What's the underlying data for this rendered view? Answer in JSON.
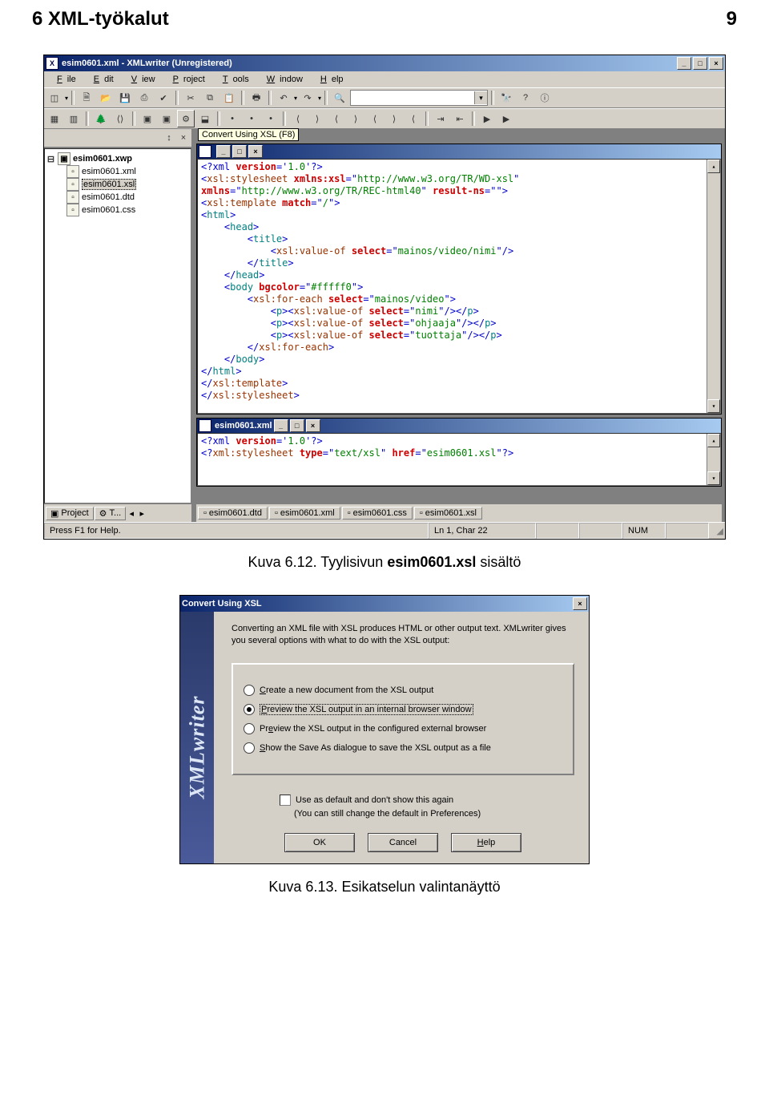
{
  "page": {
    "section": "6 XML-työkalut",
    "number": "9"
  },
  "caption1": {
    "prefix": "Kuva 6.12. Tyylisivun ",
    "bold": "esim0601.xsl",
    "suffix": " sisältö"
  },
  "caption2": "Kuva 6.13. Esikatselun valintanäyttö",
  "app": {
    "title": "esim0601.xml - XMLwriter (Unregistered)",
    "menus": [
      "File",
      "Edit",
      "View",
      "Project",
      "Tools",
      "Window",
      "Help"
    ],
    "tooltip": "Convert Using XSL (F8)",
    "tree": {
      "root": "esim0601.xwp",
      "items": [
        "esim0601.xml",
        "esim0601.xsl",
        "esim0601.dtd",
        "esim0601.css"
      ],
      "selected": 1
    },
    "side_tabs": {
      "project": "Project",
      "other": "T..."
    },
    "child1_title": "",
    "code1_lines": [
      {
        "segs": [
          {
            "c": "c-blue",
            "t": "<?xml "
          },
          {
            "c": "c-red",
            "t": "version"
          },
          {
            "c": "c-blue",
            "t": "='"
          },
          {
            "c": "c-grn",
            "t": "1.0"
          },
          {
            "c": "c-blue",
            "t": "'?>"
          }
        ]
      },
      {
        "segs": [
          {
            "c": "c-blue",
            "t": "<"
          },
          {
            "c": "c-brown",
            "t": "xsl:stylesheet "
          },
          {
            "c": "c-red",
            "t": "xmlns:xsl"
          },
          {
            "c": "c-blue",
            "t": "=\""
          },
          {
            "c": "c-grn",
            "t": "http://www.w3.org/TR/WD-xsl"
          },
          {
            "c": "c-blue",
            "t": "\""
          }
        ]
      },
      {
        "segs": [
          {
            "c": "c-red",
            "t": "xmlns"
          },
          {
            "c": "c-blue",
            "t": "=\""
          },
          {
            "c": "c-grn",
            "t": "http://www.w3.org/TR/REC-html40"
          },
          {
            "c": "c-blue",
            "t": "\" "
          },
          {
            "c": "c-red",
            "t": "result-ns"
          },
          {
            "c": "c-blue",
            "t": "=\"\">"
          }
        ]
      },
      {
        "segs": [
          {
            "c": "c-blue",
            "t": "<"
          },
          {
            "c": "c-brown",
            "t": "xsl:template "
          },
          {
            "c": "c-red",
            "t": "match"
          },
          {
            "c": "c-blue",
            "t": "=\""
          },
          {
            "c": "c-grn",
            "t": "/"
          },
          {
            "c": "c-blue",
            "t": "\">"
          }
        ]
      },
      {
        "segs": [
          {
            "c": "c-blue",
            "t": "<"
          },
          {
            "c": "c-teal",
            "t": "html"
          },
          {
            "c": "c-blue",
            "t": ">"
          }
        ]
      },
      {
        "segs": [
          {
            "c": "",
            "t": "    "
          },
          {
            "c": "c-blue",
            "t": "<"
          },
          {
            "c": "c-teal",
            "t": "head"
          },
          {
            "c": "c-blue",
            "t": ">"
          }
        ]
      },
      {
        "segs": [
          {
            "c": "",
            "t": "        "
          },
          {
            "c": "c-blue",
            "t": "<"
          },
          {
            "c": "c-teal",
            "t": "title"
          },
          {
            "c": "c-blue",
            "t": ">"
          }
        ]
      },
      {
        "segs": [
          {
            "c": "",
            "t": "            "
          },
          {
            "c": "c-blue",
            "t": "<"
          },
          {
            "c": "c-brown",
            "t": "xsl:value-of "
          },
          {
            "c": "c-red",
            "t": "select"
          },
          {
            "c": "c-blue",
            "t": "=\""
          },
          {
            "c": "c-grn",
            "t": "mainos/video/nimi"
          },
          {
            "c": "c-blue",
            "t": "\"/>"
          }
        ]
      },
      {
        "segs": [
          {
            "c": "",
            "t": "        "
          },
          {
            "c": "c-blue",
            "t": "</"
          },
          {
            "c": "c-teal",
            "t": "title"
          },
          {
            "c": "c-blue",
            "t": ">"
          }
        ]
      },
      {
        "segs": [
          {
            "c": "",
            "t": "    "
          },
          {
            "c": "c-blue",
            "t": "</"
          },
          {
            "c": "c-teal",
            "t": "head"
          },
          {
            "c": "c-blue",
            "t": ">"
          }
        ]
      },
      {
        "segs": [
          {
            "c": "",
            "t": "    "
          },
          {
            "c": "c-blue",
            "t": "<"
          },
          {
            "c": "c-teal",
            "t": "body "
          },
          {
            "c": "c-red",
            "t": "bgcolor"
          },
          {
            "c": "c-blue",
            "t": "=\""
          },
          {
            "c": "c-grn",
            "t": "#fffff0"
          },
          {
            "c": "c-blue",
            "t": "\">"
          }
        ]
      },
      {
        "segs": [
          {
            "c": "",
            "t": "        "
          },
          {
            "c": "c-blue",
            "t": "<"
          },
          {
            "c": "c-brown",
            "t": "xsl:for-each "
          },
          {
            "c": "c-red",
            "t": "select"
          },
          {
            "c": "c-blue",
            "t": "=\""
          },
          {
            "c": "c-grn",
            "t": "mainos/video"
          },
          {
            "c": "c-blue",
            "t": "\">"
          }
        ]
      },
      {
        "segs": [
          {
            "c": "",
            "t": "            "
          },
          {
            "c": "c-blue",
            "t": "<"
          },
          {
            "c": "c-teal",
            "t": "p"
          },
          {
            "c": "c-blue",
            "t": "><"
          },
          {
            "c": "c-brown",
            "t": "xsl:value-of "
          },
          {
            "c": "c-red",
            "t": "select"
          },
          {
            "c": "c-blue",
            "t": "=\""
          },
          {
            "c": "c-grn",
            "t": "nimi"
          },
          {
            "c": "c-blue",
            "t": "\"/></"
          },
          {
            "c": "c-teal",
            "t": "p"
          },
          {
            "c": "c-blue",
            "t": ">"
          }
        ]
      },
      {
        "segs": [
          {
            "c": "",
            "t": "            "
          },
          {
            "c": "c-blue",
            "t": "<"
          },
          {
            "c": "c-teal",
            "t": "p"
          },
          {
            "c": "c-blue",
            "t": "><"
          },
          {
            "c": "c-brown",
            "t": "xsl:value-of "
          },
          {
            "c": "c-red",
            "t": "select"
          },
          {
            "c": "c-blue",
            "t": "=\""
          },
          {
            "c": "c-grn",
            "t": "ohjaaja"
          },
          {
            "c": "c-blue",
            "t": "\"/></"
          },
          {
            "c": "c-teal",
            "t": "p"
          },
          {
            "c": "c-blue",
            "t": ">"
          }
        ]
      },
      {
        "segs": [
          {
            "c": "",
            "t": "            "
          },
          {
            "c": "c-blue",
            "t": "<"
          },
          {
            "c": "c-teal",
            "t": "p"
          },
          {
            "c": "c-blue",
            "t": "><"
          },
          {
            "c": "c-brown",
            "t": "xsl:value-of "
          },
          {
            "c": "c-red",
            "t": "select"
          },
          {
            "c": "c-blue",
            "t": "=\""
          },
          {
            "c": "c-grn",
            "t": "tuottaja"
          },
          {
            "c": "c-blue",
            "t": "\"/></"
          },
          {
            "c": "c-teal",
            "t": "p"
          },
          {
            "c": "c-blue",
            "t": ">"
          }
        ]
      },
      {
        "segs": [
          {
            "c": "",
            "t": "        "
          },
          {
            "c": "c-blue",
            "t": "</"
          },
          {
            "c": "c-brown",
            "t": "xsl:for-each"
          },
          {
            "c": "c-blue",
            "t": ">"
          }
        ]
      },
      {
        "segs": [
          {
            "c": "",
            "t": "    "
          },
          {
            "c": "c-blue",
            "t": "</"
          },
          {
            "c": "c-teal",
            "t": "body"
          },
          {
            "c": "c-blue",
            "t": ">"
          }
        ]
      },
      {
        "segs": [
          {
            "c": "c-blue",
            "t": "</"
          },
          {
            "c": "c-teal",
            "t": "html"
          },
          {
            "c": "c-blue",
            "t": ">"
          }
        ]
      },
      {
        "segs": [
          {
            "c": "c-blue",
            "t": "</"
          },
          {
            "c": "c-brown",
            "t": "xsl:template"
          },
          {
            "c": "c-blue",
            "t": ">"
          }
        ]
      },
      {
        "segs": [
          {
            "c": "c-blue",
            "t": "</"
          },
          {
            "c": "c-brown",
            "t": "xsl:stylesheet"
          },
          {
            "c": "c-blue",
            "t": ">"
          }
        ]
      }
    ],
    "child2_title": "esim0601.xml",
    "code2_lines": [
      {
        "segs": [
          {
            "c": "c-blue",
            "t": "<?xml "
          },
          {
            "c": "c-red",
            "t": "version"
          },
          {
            "c": "c-blue",
            "t": "='"
          },
          {
            "c": "c-grn",
            "t": "1.0"
          },
          {
            "c": "c-blue",
            "t": "'?>"
          }
        ]
      },
      {
        "segs": [
          {
            "c": "c-blue",
            "t": "<?"
          },
          {
            "c": "c-brown",
            "t": "xml:stylesheet "
          },
          {
            "c": "c-red",
            "t": "type"
          },
          {
            "c": "c-blue",
            "t": "=\""
          },
          {
            "c": "c-grn",
            "t": "text/xsl"
          },
          {
            "c": "c-blue",
            "t": "\" "
          },
          {
            "c": "c-red",
            "t": "href"
          },
          {
            "c": "c-blue",
            "t": "=\""
          },
          {
            "c": "c-grn",
            "t": "esim0601.xsl"
          },
          {
            "c": "c-blue",
            "t": "\"?>"
          }
        ]
      }
    ],
    "doc_tabs": [
      "esim0601.dtd",
      "esim0601.xml",
      "esim0601.css",
      "esim0601.xsl"
    ],
    "status": {
      "help": "Press F1 for Help.",
      "pos": "Ln 1, Char 22",
      "num": "NUM"
    }
  },
  "dialog": {
    "title": "Convert Using XSL",
    "logo": "XMLwriter",
    "intro": "Converting an XML file with XSL produces HTML or other output text. XMLwriter gives you several options with what to do with the XSL output:",
    "opts": [
      "Create a new document from the XSL output",
      "Preview the XSL output in an internal browser window",
      "Preview the XSL output in the configured external browser",
      "Show the Save As dialogue to save the XSL output as a file"
    ],
    "opt_underline": [
      "C",
      "P",
      "e",
      "S"
    ],
    "selected": 1,
    "chk": "Use as default and don't show this again",
    "chk_sub": "(You can still change the default in Preferences)",
    "buttons": {
      "ok": "OK",
      "cancel": "Cancel",
      "help": "Help"
    }
  }
}
